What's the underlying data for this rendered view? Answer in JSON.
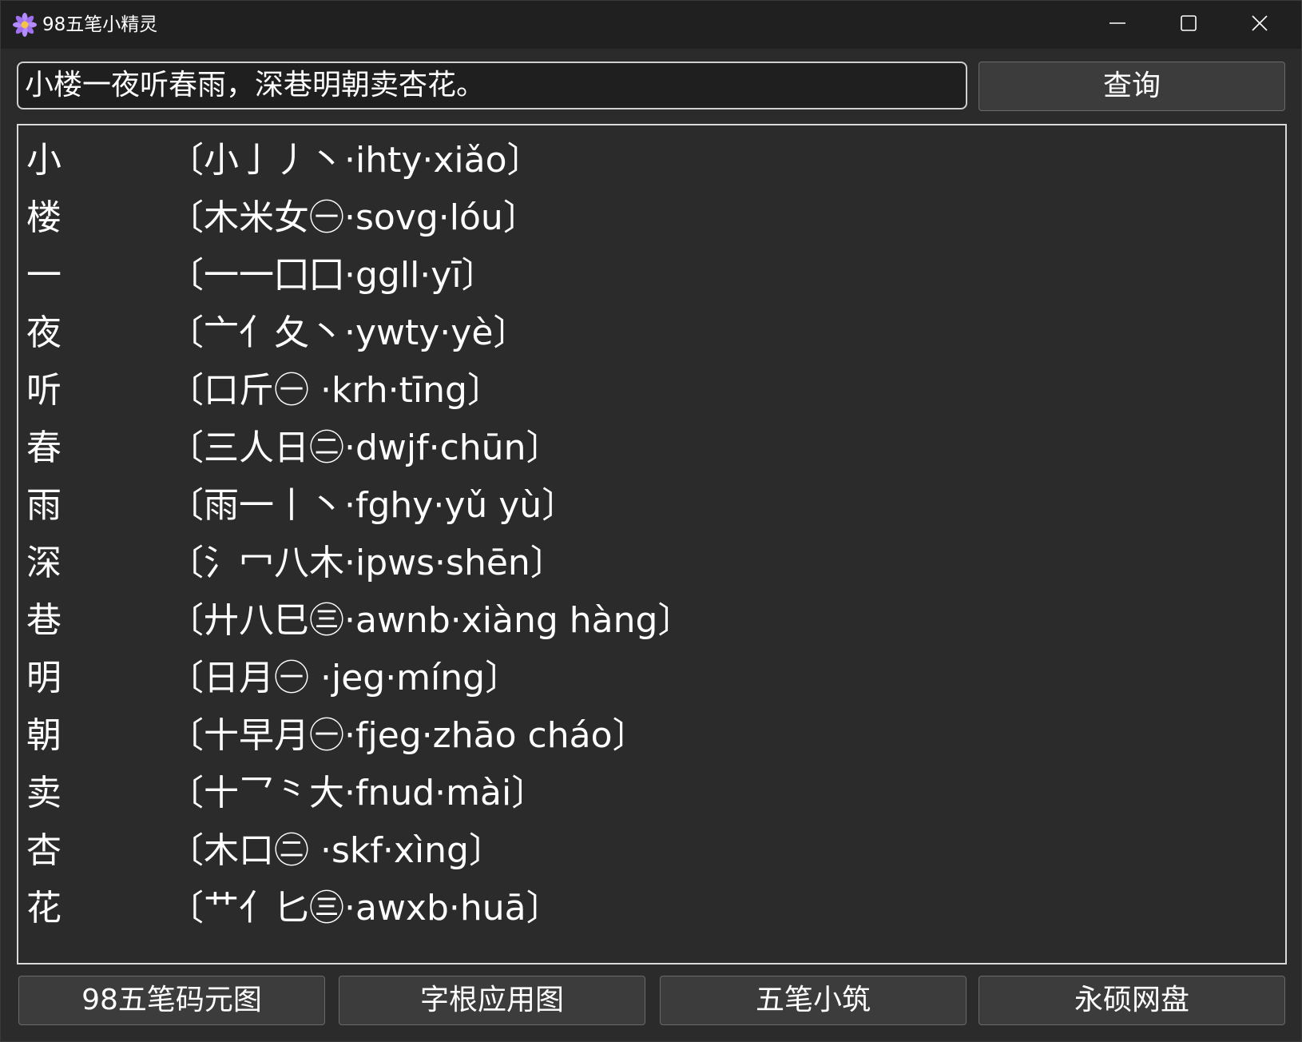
{
  "window": {
    "title": "98五笔小精灵",
    "icon": "purple-flower-icon",
    "controls": [
      "minimize-icon",
      "maximize-icon",
      "close-icon"
    ]
  },
  "search": {
    "value": "小楼一夜听春雨，深巷明朝卖杏花。",
    "button_label": "查询"
  },
  "results": [
    {
      "char": "小",
      "code": "〔小亅丿丶·ihty·xiǎo〕"
    },
    {
      "char": "楼",
      "code": "〔木米女㊀·sovg·lóu〕"
    },
    {
      "char": "一",
      "code": "〔一一囗囗·ggll·yī〕"
    },
    {
      "char": "夜",
      "code": "〔亠亻夂丶·ywty·yè〕"
    },
    {
      "char": "听",
      "code": "〔口斤㊀ ·krh·tīng〕"
    },
    {
      "char": "春",
      "code": "〔三人日㊁·dwjf·chūn〕"
    },
    {
      "char": "雨",
      "code": "〔雨一丨丶·fghy·yǔ yù〕"
    },
    {
      "char": "深",
      "code": "〔氵冖八木·ipws·shēn〕"
    },
    {
      "char": "巷",
      "code": "〔廾八巳㊂·awnb·xiàng hàng〕"
    },
    {
      "char": "明",
      "code": "〔日月㊀ ·jeg·míng〕"
    },
    {
      "char": "朝",
      "code": "〔十早月㊀·fjeg·zhāo cháo〕"
    },
    {
      "char": "卖",
      "code": "〔十乛⺀大·fnud·mài〕"
    },
    {
      "char": "杏",
      "code": "〔木口㊁ ·skf·xìng〕"
    },
    {
      "char": "花",
      "code": "〔艹亻匕㊂·awxb·huā〕"
    }
  ],
  "bottom_buttons": {
    "b1": "98五笔码元图",
    "b2": "字根应用图",
    "b3": "五笔小筑",
    "b4": "永硕网盘"
  }
}
